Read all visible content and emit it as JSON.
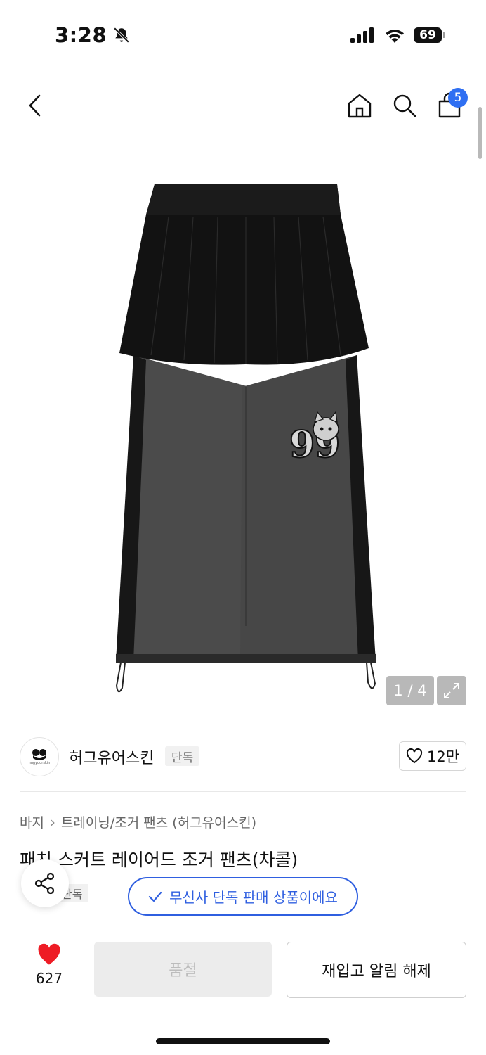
{
  "status_bar": {
    "time": "3:28",
    "icons": [
      "bell-slash-icon",
      "signal-icon",
      "wifi-icon",
      "battery-icon"
    ],
    "battery": "69"
  },
  "nav": {
    "icons": [
      "back-icon",
      "home-icon",
      "search-icon",
      "cart-icon"
    ],
    "cart_count": "5"
  },
  "gallery": {
    "counter": "1 / 4",
    "current": 1,
    "total": 4,
    "graphic_text": "99",
    "colors": {
      "skirt": "#111111",
      "pants": "#4a4a4a",
      "side_panel": "#1a1a1a"
    }
  },
  "brand": {
    "logo_text": "hugyourskin",
    "name": "허그유어스킨",
    "tag": "단독",
    "likes": "12만"
  },
  "product": {
    "breadcrumb": [
      "바지",
      "트레이닝/조거 팬츠 (허그유어스킨)"
    ],
    "title": "패치 스커트 레이어드 조거 팬츠(차콜)",
    "exclusive_tag": "단독",
    "exclusive_notice": "무신사 단독 판매 상품이에요"
  },
  "bottom_bar": {
    "wish_count": "627",
    "soldout_label": "품절",
    "restock_label": "재입고 알림 해제"
  },
  "colors": {
    "accent": "#2f5fe0",
    "badge": "#2f6ff2",
    "heart": "#ee1c25"
  }
}
